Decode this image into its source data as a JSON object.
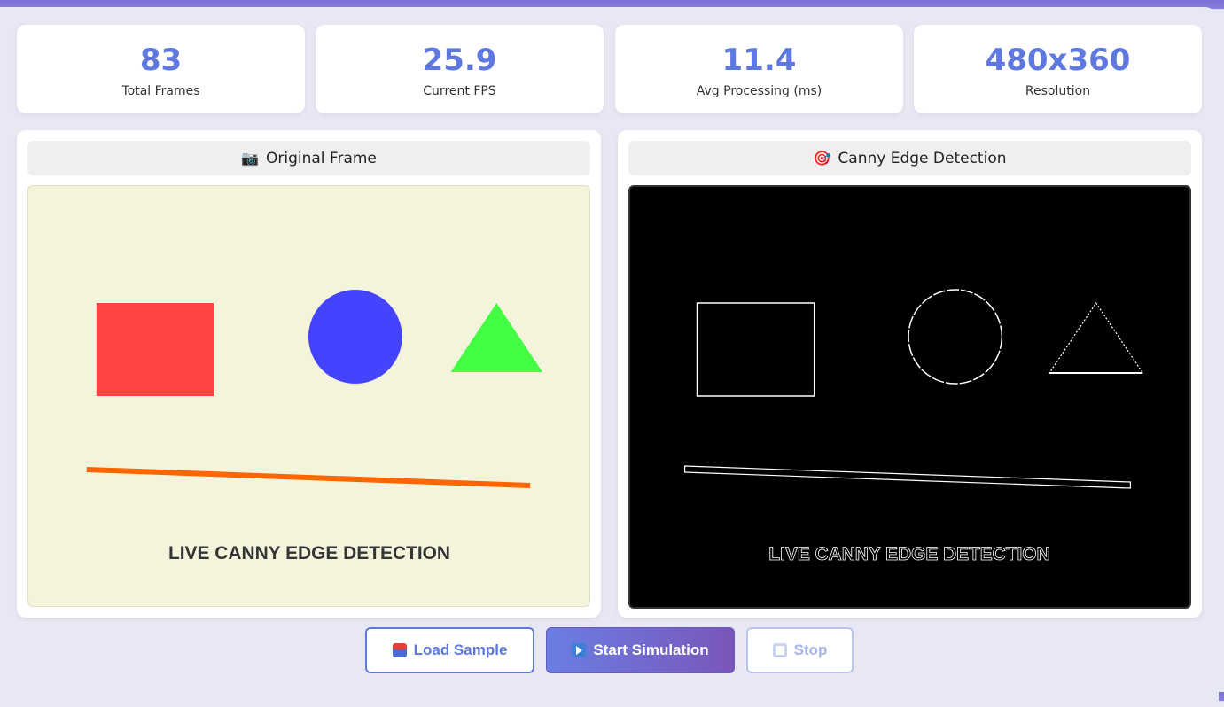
{
  "stats": [
    {
      "value": "83",
      "label": "Total Frames"
    },
    {
      "value": "25.9",
      "label": "Current FPS"
    },
    {
      "value": "11.4",
      "label": "Avg Processing (ms)"
    },
    {
      "value": "480x360",
      "label": "Resolution"
    }
  ],
  "panels": {
    "original": {
      "icon": "camera-icon",
      "title": "Original Frame",
      "overlay_text": "LIVE CANNY EDGE DETECTION"
    },
    "edges": {
      "icon": "target-icon",
      "title": "Canny Edge Detection",
      "overlay_text": "LIVE CANNY EDGE DETECTION"
    }
  },
  "buttons": {
    "load": {
      "label": "Load Sample",
      "icon": "load-icon"
    },
    "start": {
      "label": "Start Simulation",
      "icon": "play-icon"
    },
    "stop": {
      "label": "Stop",
      "icon": "stop-icon"
    }
  },
  "colors": {
    "accent": "#5f78e0",
    "square": "#ff4444",
    "circle": "#4444ff",
    "triangle": "#44ff44",
    "line": "#ff6600"
  }
}
